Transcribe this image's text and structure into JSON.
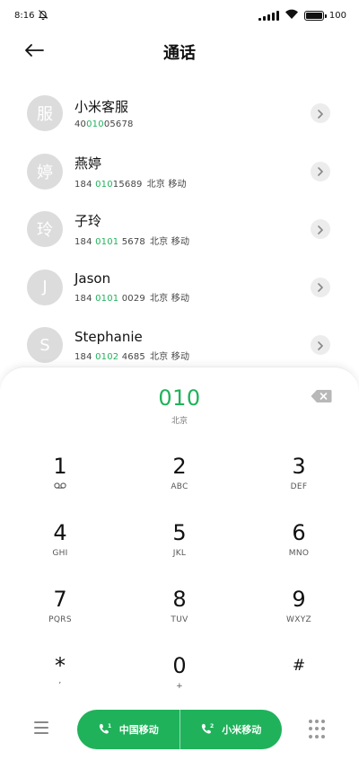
{
  "status_bar": {
    "time": "8:16",
    "battery_label": "100"
  },
  "header": {
    "title": "通话"
  },
  "contacts": [
    {
      "avatar_char": "服",
      "name": "小米客服",
      "number_pre": "40",
      "number_match": "010",
      "number_post": "05678",
      "location": ""
    },
    {
      "avatar_char": "婷",
      "name": "燕婷",
      "number_pre": "184 ",
      "number_match": "010",
      "number_post": "15689",
      "location": "北京  移动"
    },
    {
      "avatar_char": "玲",
      "name": "子玲",
      "number_pre": "184 ",
      "number_match": "0101",
      "number_post": " 5678",
      "location": "北京  移动"
    },
    {
      "avatar_char": "J",
      "name": "Jason",
      "number_pre": "184 ",
      "number_match": "0101",
      "number_post": " 0029",
      "location": "北京  移动"
    },
    {
      "avatar_char": "S",
      "name": "Stephanie",
      "number_pre": "184 ",
      "number_match": "0102",
      "number_post": " 4685",
      "location": "北京  移动"
    }
  ],
  "dialer": {
    "input": "010",
    "location": "北京"
  },
  "keypad": [
    {
      "digit": "1",
      "letters": ""
    },
    {
      "digit": "2",
      "letters": "ABC"
    },
    {
      "digit": "3",
      "letters": "DEF"
    },
    {
      "digit": "4",
      "letters": "GHI"
    },
    {
      "digit": "5",
      "letters": "JKL"
    },
    {
      "digit": "6",
      "letters": "MNO"
    },
    {
      "digit": "7",
      "letters": "PQRS"
    },
    {
      "digit": "8",
      "letters": "TUV"
    },
    {
      "digit": "9",
      "letters": "WXYZ"
    },
    {
      "digit": "*",
      "letters": ","
    },
    {
      "digit": "0",
      "letters": "+"
    },
    {
      "digit": "#",
      "letters": ""
    }
  ],
  "call_buttons": {
    "sim1_label": "中国移动",
    "sim2_label": "小米移动"
  },
  "colors": {
    "accent": "#1fb25a"
  },
  "icons": {
    "back": "arrow-left-icon",
    "mute": "bell-off-icon",
    "wifi": "wifi-icon",
    "signal": "signal-icon",
    "battery": "battery-icon",
    "detail": "chevron-right-icon",
    "backspace": "backspace-icon",
    "voicemail": "voicemail-icon",
    "menu": "menu-icon",
    "keypad": "keypad-icon",
    "sim1": "sim1-call-icon",
    "sim2": "sim2-call-icon"
  }
}
